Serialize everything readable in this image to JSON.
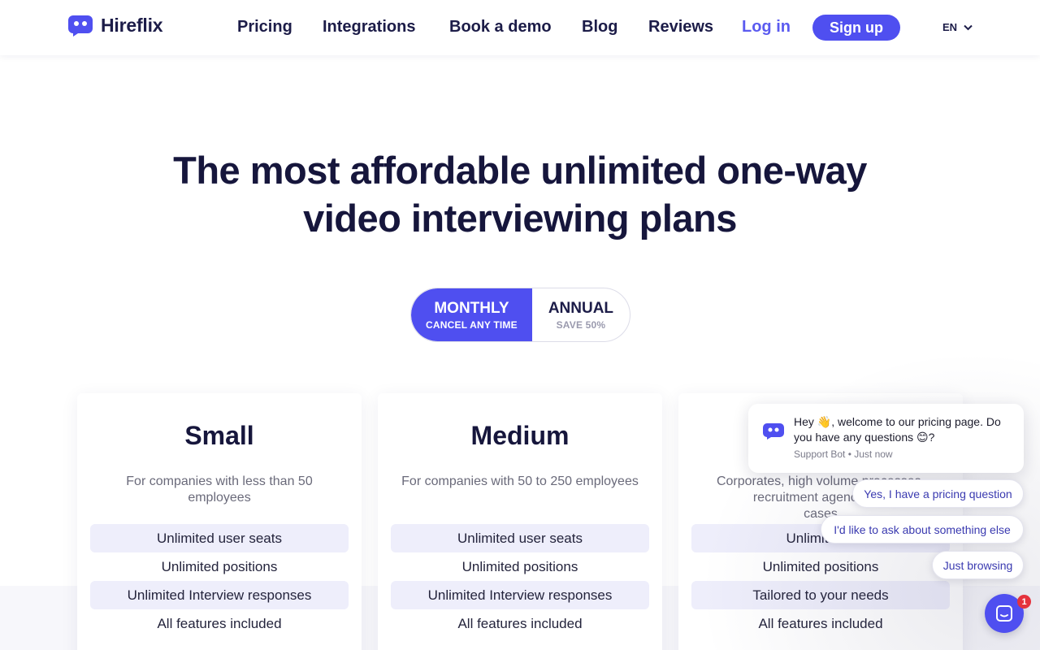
{
  "nav": {
    "brand": "Hireflix",
    "links": [
      "Pricing",
      "Integrations",
      "Book a demo",
      "Blog",
      "Reviews"
    ],
    "login": "Log in",
    "signup": "Sign up",
    "language": "EN"
  },
  "hero": {
    "title_line1": "The most affordable unlimited one-way",
    "title_line2": "video interviewing plans"
  },
  "billing_toggle": {
    "monthly": {
      "label": "MONTHLY",
      "sub": "CANCEL ANY TIME",
      "selected": true
    },
    "annual": {
      "label": "ANNUAL",
      "sub": "SAVE 50%",
      "selected": false
    }
  },
  "plans": [
    {
      "name": "Small",
      "desc": "For companies with less than 50 employees",
      "features": [
        "Unlimited user seats",
        "Unlimited positions",
        "Unlimited Interview responses",
        "All features included"
      ]
    },
    {
      "name": "Medium",
      "desc": "For companies with 50 to 250 employees",
      "features": [
        "Unlimited user seats",
        "Unlimited positions",
        "Unlimited Interview responses",
        "All features included"
      ]
    },
    {
      "name": "",
      "desc": "Corporates, high volume processes, recruitment agencies, a... cases",
      "desc_partial": [
        "Corporates, high volume processes,",
        "recruitment agencies, a",
        "cases"
      ],
      "features": [
        "Unlimited u",
        "Unlimited positions",
        "Tailored to your needs",
        "All features included"
      ]
    }
  ],
  "chat": {
    "message": "Hey 👋, welcome to our pricing page. Do you have any questions 😊?",
    "meta": "Support Bot • Just now",
    "options": [
      "Yes, I have a pricing question",
      "I'd like to ask about something else",
      "Just browsing"
    ],
    "badge_count": "1"
  },
  "colors": {
    "accent": "#4f4ff0",
    "heading": "#16163c",
    "shaded_row": "#eeeefb",
    "badge": "#e5333d"
  }
}
